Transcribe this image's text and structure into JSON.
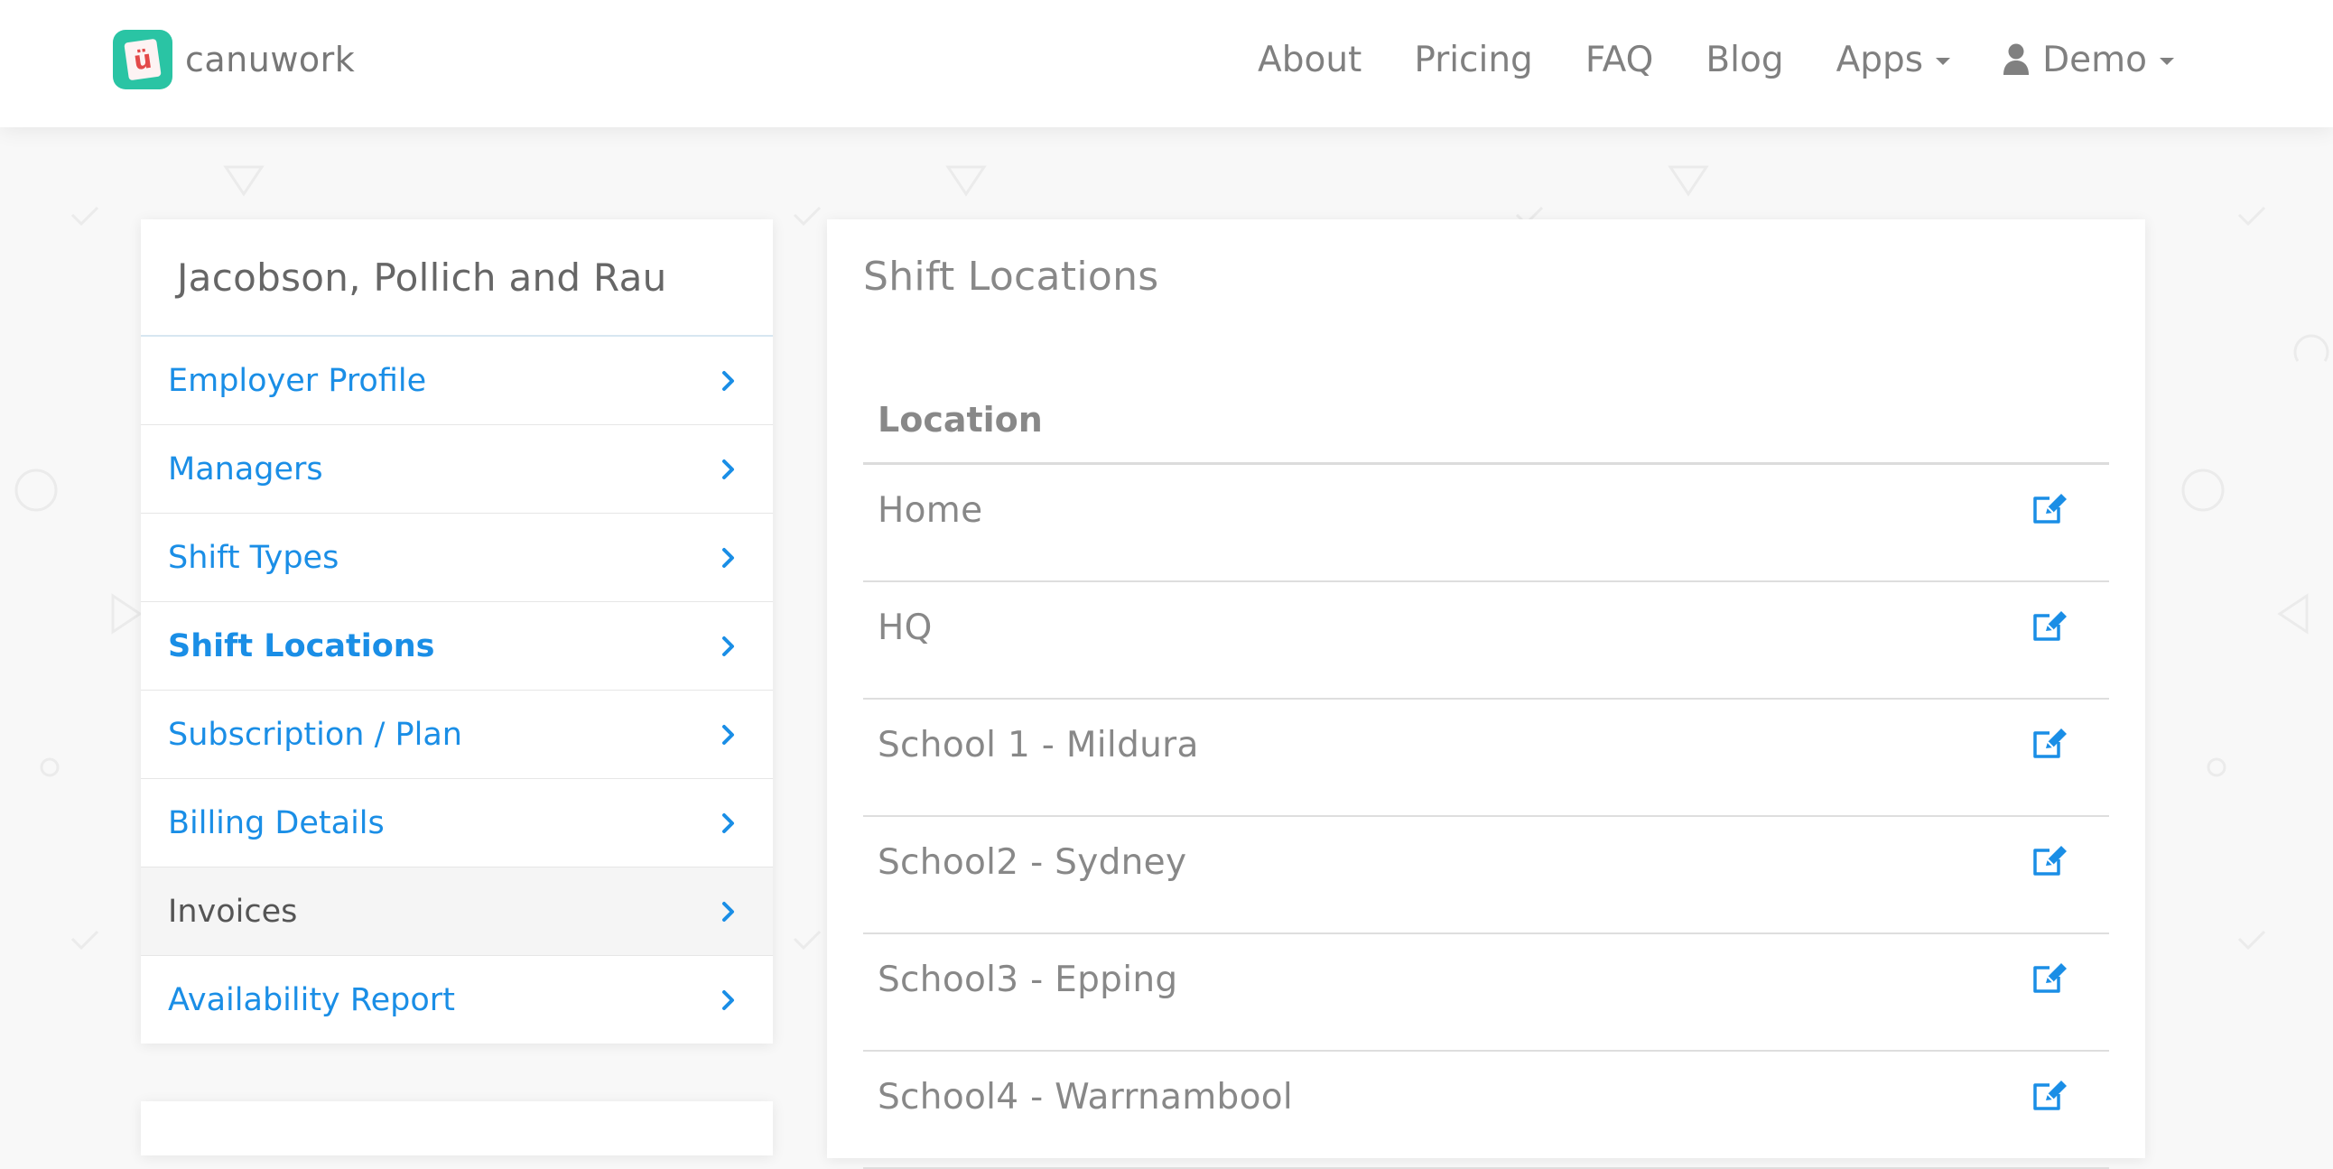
{
  "brand": {
    "name": "canuwork",
    "logo_glyph": "ü",
    "logo_color": "#2ac4a4"
  },
  "nav": {
    "about": "About",
    "pricing": "Pricing",
    "faq": "FAQ",
    "blog": "Blog",
    "apps": "Apps",
    "user": "Demo"
  },
  "sidebar": {
    "title": "Jacobson, Pollich and Rau",
    "items": [
      {
        "label": "Employer Profile"
      },
      {
        "label": "Managers"
      },
      {
        "label": "Shift Types"
      },
      {
        "label": "Shift Locations"
      },
      {
        "label": "Subscription / Plan"
      },
      {
        "label": "Billing Details"
      },
      {
        "label": "Invoices"
      },
      {
        "label": "Availability Report"
      }
    ]
  },
  "main": {
    "title": "Shift Locations",
    "column_header": "Location",
    "rows": [
      {
        "name": "Home"
      },
      {
        "name": "HQ"
      },
      {
        "name": "School 1 - Mildura"
      },
      {
        "name": "School2 - Sydney"
      },
      {
        "name": "School3 - Epping"
      },
      {
        "name": "School4 - Warrnambool"
      }
    ]
  },
  "colors": {
    "link": "#1a8ee6",
    "text_muted": "#888888"
  },
  "icons": {
    "chevron": "chevron-right-icon",
    "edit": "edit-icon",
    "user": "user-icon",
    "caret": "caret-down-icon"
  }
}
